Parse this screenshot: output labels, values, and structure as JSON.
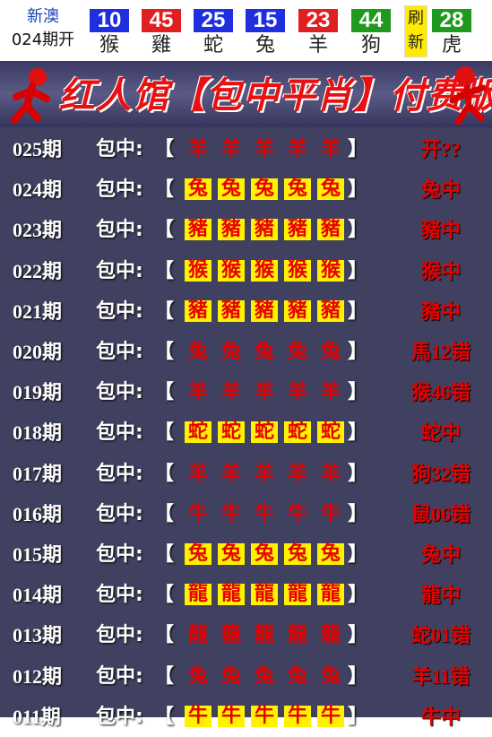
{
  "header": {
    "brand_line1": "新澳",
    "brand_line2": "024期开",
    "balls": [
      {
        "number": "10",
        "zodiac": "猴",
        "color": "#1f2fe0"
      },
      {
        "number": "45",
        "zodiac": "雞",
        "color": "#e02020"
      },
      {
        "number": "25",
        "zodiac": "蛇",
        "color": "#1f2fe0"
      },
      {
        "number": "15",
        "zodiac": "兔",
        "color": "#1f2fe0"
      },
      {
        "number": "23",
        "zodiac": "羊",
        "color": "#e02020"
      },
      {
        "number": "44",
        "zodiac": "狗",
        "color": "#1e9a1e"
      }
    ],
    "refresh_top": "刷",
    "refresh_bottom": "新",
    "special": {
      "number": "28",
      "zodiac": "虎",
      "color": "#1e9a1e"
    }
  },
  "banner": {
    "title": "红人馆【包中平肖】付费版"
  },
  "list": {
    "label": "包中:",
    "open_bracket": "【",
    "close_bracket": "】",
    "rows": [
      {
        "period": "025期",
        "zodiac": "羊",
        "highlight": false,
        "result": "开??"
      },
      {
        "period": "024期",
        "zodiac": "兔",
        "highlight": true,
        "result": "兔中"
      },
      {
        "period": "023期",
        "zodiac": "豬",
        "highlight": true,
        "result": "豬中"
      },
      {
        "period": "022期",
        "zodiac": "猴",
        "highlight": true,
        "result": "猴中"
      },
      {
        "period": "021期",
        "zodiac": "豬",
        "highlight": true,
        "result": "豬中"
      },
      {
        "period": "020期",
        "zodiac": "兔",
        "highlight": false,
        "result": "馬12错"
      },
      {
        "period": "019期",
        "zodiac": "羊",
        "highlight": false,
        "result": "猴46错"
      },
      {
        "period": "018期",
        "zodiac": "蛇",
        "highlight": true,
        "result": "蛇中"
      },
      {
        "period": "017期",
        "zodiac": "羊",
        "highlight": false,
        "result": "狗32错"
      },
      {
        "period": "016期",
        "zodiac": "牛",
        "highlight": false,
        "result": "鼠06错"
      },
      {
        "period": "015期",
        "zodiac": "兔",
        "highlight": true,
        "result": "兔中"
      },
      {
        "period": "014期",
        "zodiac": "龍",
        "highlight": true,
        "result": "龍中"
      },
      {
        "period": "013期",
        "zodiac": "龍",
        "highlight": false,
        "result": "蛇01错"
      },
      {
        "period": "012期",
        "zodiac": "兔",
        "highlight": false,
        "result": "羊11错"
      },
      {
        "period": "011期",
        "zodiac": "牛",
        "highlight": true,
        "result": "牛中"
      }
    ]
  }
}
